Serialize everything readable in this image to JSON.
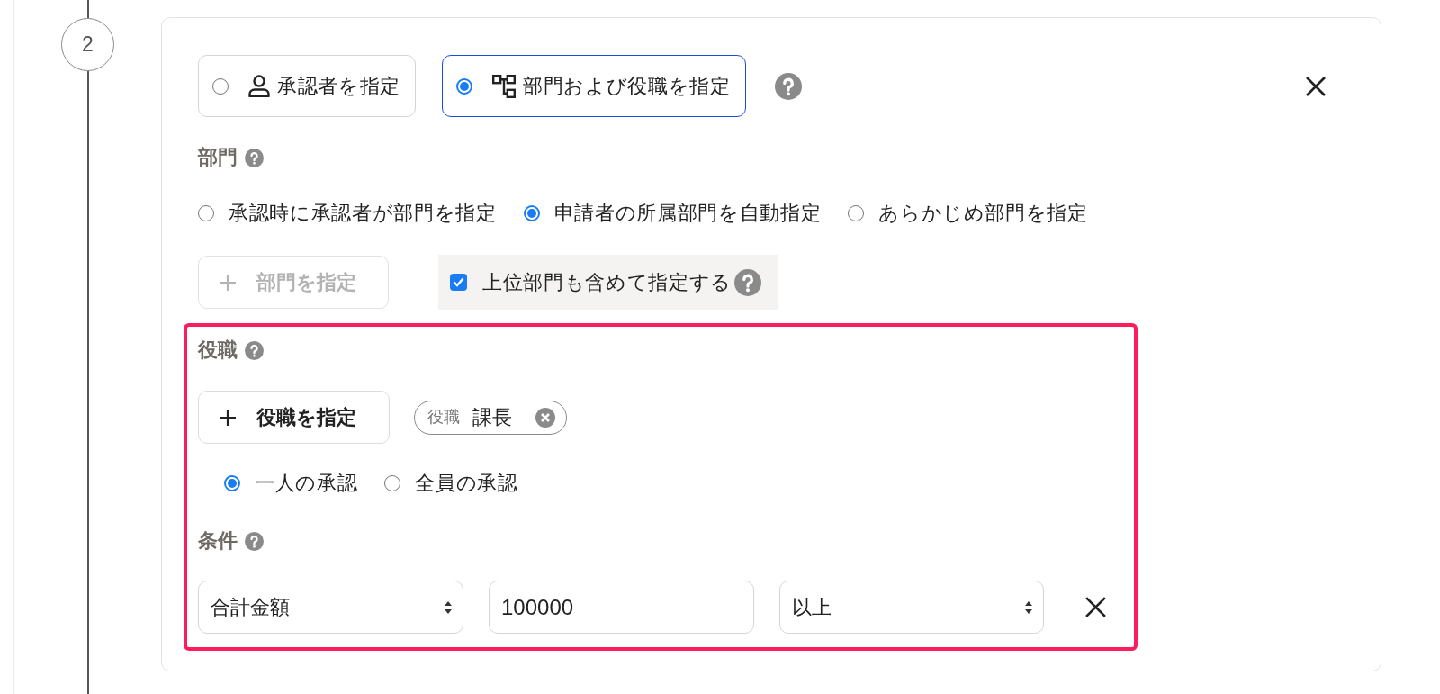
{
  "step": {
    "number": "2"
  },
  "approver_type": {
    "options": [
      {
        "kind": "person",
        "label": "承認者を指定",
        "selected": false
      },
      {
        "kind": "org",
        "label": "部門および役職を指定",
        "selected": true
      }
    ]
  },
  "department": {
    "label": "部門",
    "modes": [
      {
        "label": "承認時に承認者が部門を指定",
        "selected": false
      },
      {
        "label": "申請者の所属部門を自動指定",
        "selected": true
      },
      {
        "label": "あらかじめ部門を指定",
        "selected": false
      }
    ],
    "add_button": {
      "label": "部門を指定",
      "disabled": true
    },
    "include_parent": {
      "label": "上位部門も含めて指定する",
      "checked": true
    }
  },
  "position": {
    "highlighted": true,
    "label": "役職",
    "add_button": {
      "label": "役職を指定",
      "disabled": false
    },
    "tags": [
      {
        "category": "役職",
        "value": "課長"
      }
    ],
    "approval_modes": [
      {
        "label": "一人の承認",
        "selected": true
      },
      {
        "label": "全員の承認",
        "selected": false
      }
    ]
  },
  "conditions": {
    "label": "条件",
    "rows": [
      {
        "field": "合計金額",
        "value": "100000",
        "operator": "以上"
      }
    ]
  }
}
